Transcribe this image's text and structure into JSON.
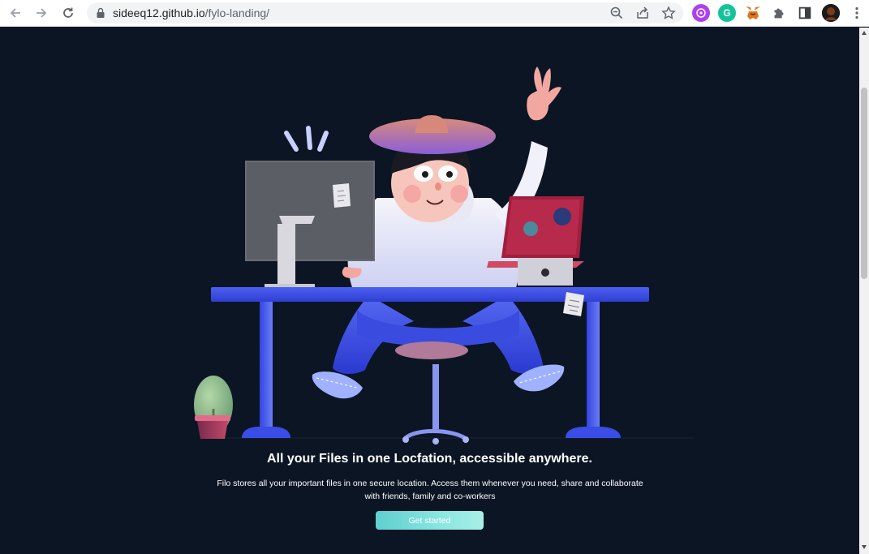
{
  "browser": {
    "url_host": "sideeq12.github.io",
    "url_path": "/fylo-landing/",
    "icons": {
      "back": "arrow-left-icon",
      "forward": "arrow-right-icon",
      "reload": "reload-icon",
      "lock": "lock-icon",
      "zoom": "zoom-out-icon",
      "share": "share-icon",
      "bookmark": "star-icon",
      "extensions": [
        "color-picker-extension-icon",
        "grammarly-icon",
        "metamask-fox-icon",
        "puzzle-extensions-icon"
      ],
      "side_panel": "side-panel-icon",
      "profile": "profile-avatar",
      "menu": "kebab-menu-icon"
    },
    "grammarly_letter": "G"
  },
  "hero": {
    "title": "All your Files in one Locfation, accessible anywhere.",
    "description": "Filo stores all your important files in one secure location. Access them whenever you need, share and collaborate with friends, family and co-workers",
    "cta_label": "Get started"
  },
  "colors": {
    "page_bg": "#0c1524",
    "desk": "#3c4fe0",
    "cta_start": "#5fcfd0",
    "cta_end": "#a7f0e6"
  }
}
